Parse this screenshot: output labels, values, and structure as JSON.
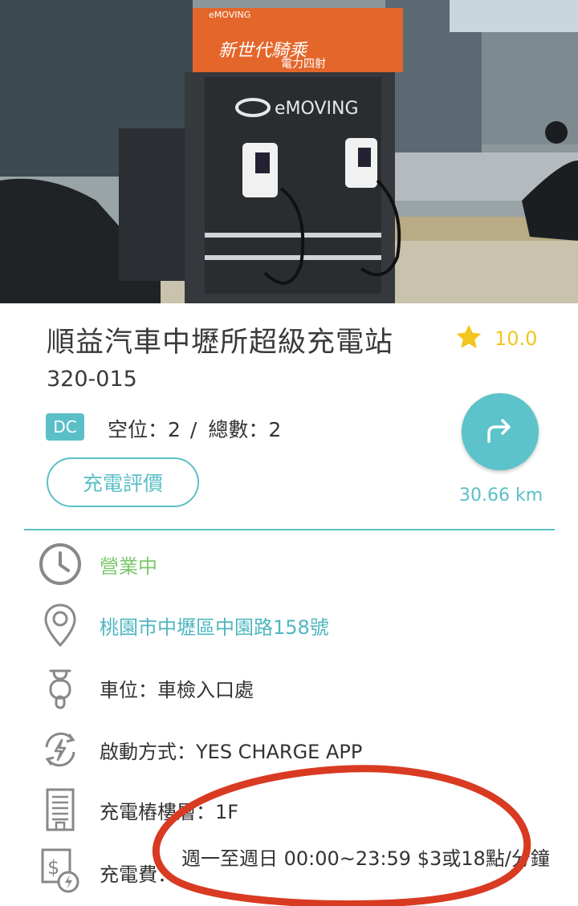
{
  "hero": {
    "banner_line1": "新世代騎乘",
    "banner_line2": "電力四射",
    "brand": "eMOVING",
    "brand_top": "eMOVING"
  },
  "station": {
    "name": "順益汽車中壢所超級充電站",
    "rating": "10.0",
    "code": "320-015",
    "type_badge": "DC",
    "available_label": "空位：2",
    "separator": "/",
    "total_label": "總數：2",
    "review_button": "充電評價",
    "distance": "30.66 km"
  },
  "details": {
    "hours_status": "營業中",
    "address": "桃園市中壢區中園路158號",
    "parking": "車位：車檢入口處",
    "start_method": "啟動方式：YES CHARGE APP",
    "floor": "充電樁樓層：1F",
    "fee_label": "充電費：",
    "fee_value": "週一至週日 00:00~23:59 $3或18點/分鐘"
  },
  "colors": {
    "accent": "#5bbfc7",
    "star": "#f2c61f",
    "open_green": "#7bc76a",
    "annotation_red": "#d93a22"
  },
  "icons": {
    "rating": "star-icon",
    "navigate": "share-arrow-icon",
    "hours": "clock-icon",
    "address": "map-pin-icon",
    "parking": "scooter-icon",
    "start": "power-swap-icon",
    "floor": "building-icon",
    "fee": "fee-icon"
  }
}
